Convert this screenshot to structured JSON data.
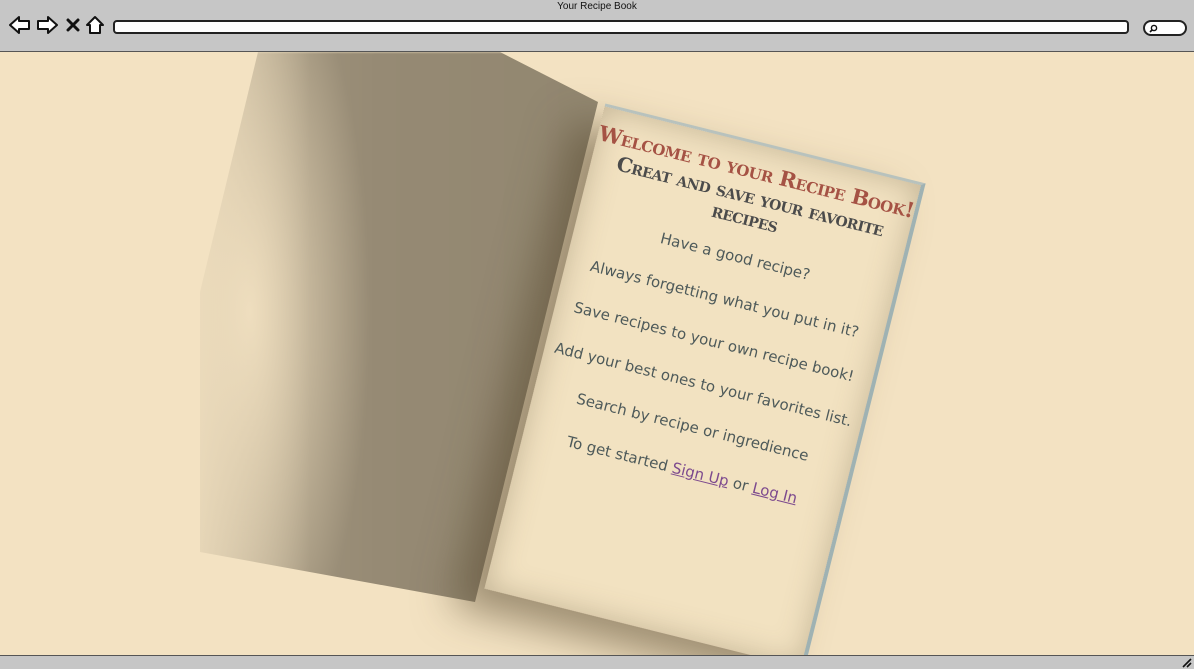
{
  "window": {
    "title": "Your Recipe Book"
  },
  "toolbar": {
    "back_icon": "arrow-left-icon",
    "forward_icon": "arrow-right-icon",
    "stop_icon": "close-x-icon",
    "home_icon": "home-icon",
    "address_value": "",
    "search_icon": "search-icon"
  },
  "book": {
    "title": "Welcome to your Recipe Book!",
    "subtitle": "Creat and save your favorite recipes",
    "lines": [
      "Have a good recipe?",
      "Always forgetting what you put in it?",
      "Save recipes to your own recipe book!",
      "Add your best ones to your favorites list.",
      "Search by recipe or ingredience"
    ],
    "cta_prefix": "To get started",
    "signup_label": "Sign Up",
    "or_label": "or",
    "login_label": "Log In"
  },
  "colors": {
    "background": "#f3e2c2",
    "title": "#a55244",
    "link": "#7d4a8e",
    "chrome": "#c6c6c6"
  }
}
